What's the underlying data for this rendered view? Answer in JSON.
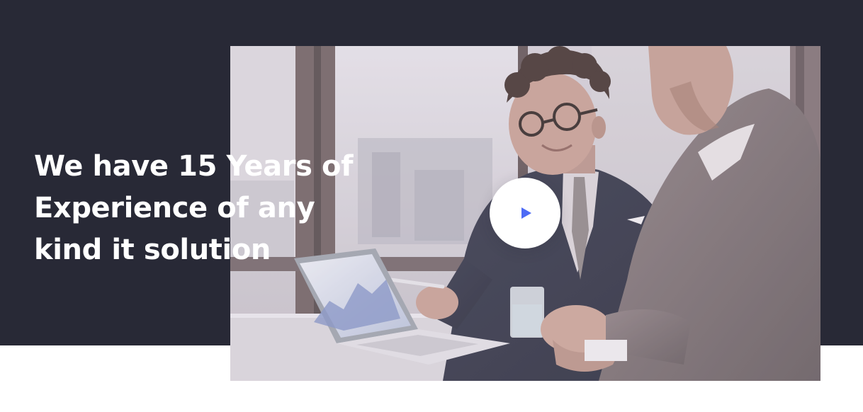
{
  "hero": {
    "headline_lines": [
      "We have 15 Years of",
      "Experience of any",
      "kind it solution"
    ]
  },
  "video": {
    "play_icon": "play-icon",
    "image_subject": "business-meeting-photo"
  },
  "colors": {
    "dark_band": "#282936",
    "headline_text": "#ffffff",
    "play_button_bg": "#ffffff",
    "play_icon": "#4d6bf5"
  }
}
